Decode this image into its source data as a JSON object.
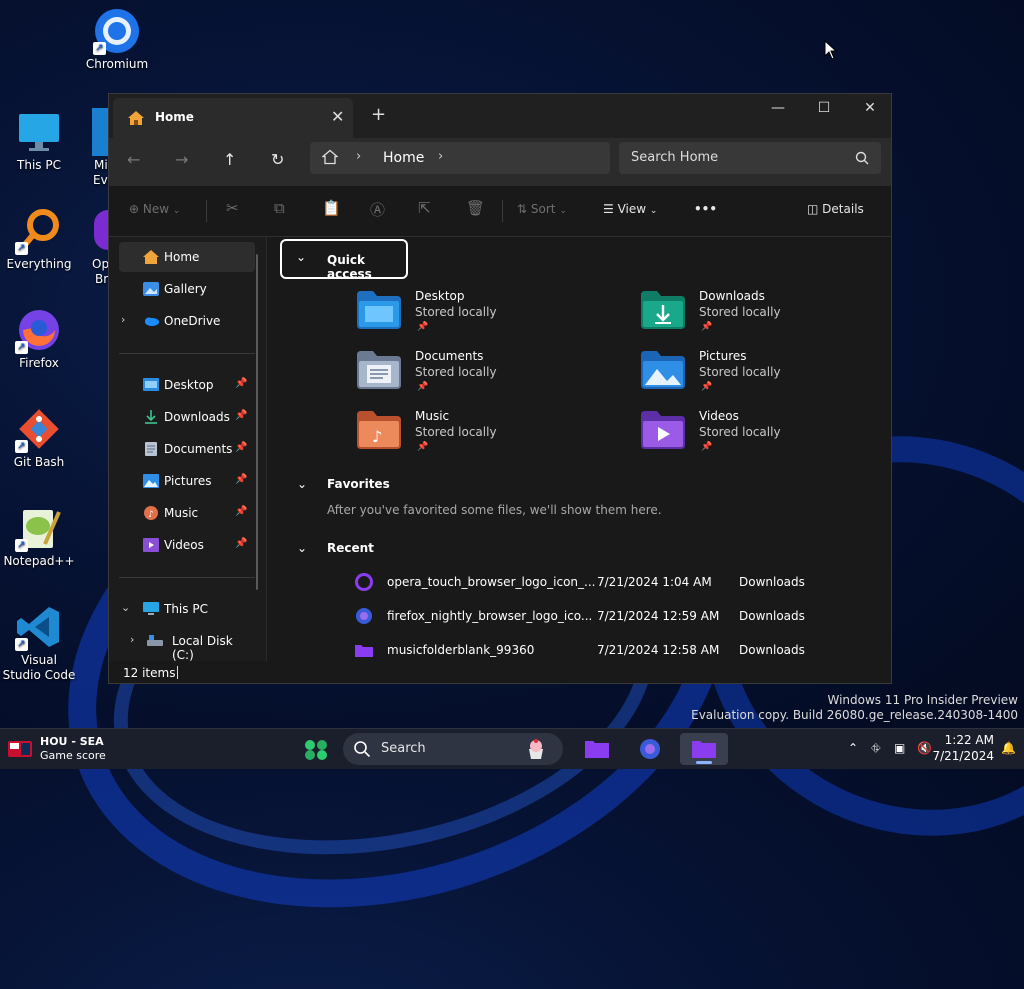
{
  "desktop": {
    "icons": [
      {
        "label": "Chromium",
        "icon": "chromium-icon"
      },
      {
        "label": "This PC",
        "icon": "this-pc-icon"
      },
      {
        "label": "Everything",
        "icon": "everything-icon"
      },
      {
        "label": "Firefox",
        "icon": "firefox-icon"
      },
      {
        "label": "Git Bash",
        "icon": "git-bash-icon"
      },
      {
        "label": "Notepad++",
        "icon": "notepadpp-icon"
      },
      {
        "label": "Visual Studio Code",
        "icon": "vscode-icon"
      }
    ],
    "partial_labels": [
      "Mi",
      "Eve",
      "Op",
      "Br"
    ]
  },
  "window": {
    "tab_title": "Home",
    "address": {
      "crumb": "Home"
    },
    "search_placeholder": "Search Home",
    "toolbar": {
      "new": "New",
      "sort": "Sort",
      "view": "View",
      "more": "•••",
      "details": "Details"
    },
    "sidebar": {
      "top": [
        {
          "label": "Home",
          "icon": "home-icon"
        },
        {
          "label": "Gallery",
          "icon": "gallery-icon"
        },
        {
          "label": "OneDrive",
          "icon": "onedrive-icon"
        }
      ],
      "pinned": [
        {
          "label": "Desktop",
          "icon": "desktop-folder-icon"
        },
        {
          "label": "Downloads",
          "icon": "downloads-folder-icon"
        },
        {
          "label": "Documents",
          "icon": "documents-folder-icon"
        },
        {
          "label": "Pictures",
          "icon": "pictures-folder-icon"
        },
        {
          "label": "Music",
          "icon": "music-folder-icon"
        },
        {
          "label": "Videos",
          "icon": "videos-folder-icon"
        }
      ],
      "this_pc": "This PC",
      "local_disk": "Local Disk (C:)"
    },
    "quick_access": {
      "title": "Quick access",
      "folders": [
        {
          "name": "Desktop",
          "status": "Stored locally",
          "color": "#2a8ce0"
        },
        {
          "name": "Downloads",
          "status": "Stored locally",
          "color": "#1aa88a"
        },
        {
          "name": "Documents",
          "status": "Stored locally",
          "color": "#8a9ab4"
        },
        {
          "name": "Pictures",
          "status": "Stored locally",
          "color": "#2f8fe6"
        },
        {
          "name": "Music",
          "status": "Stored locally",
          "color": "#e0704a"
        },
        {
          "name": "Videos",
          "status": "Stored locally",
          "color": "#8a4fd6"
        }
      ]
    },
    "favorites": {
      "title": "Favorites",
      "note": "After you've favorited some files, we'll show them here."
    },
    "recent": {
      "title": "Recent",
      "rows": [
        {
          "name": "opera_touch_browser_logo_icon_...",
          "date": "7/21/2024 1:04 AM",
          "location": "Downloads",
          "icon": "opera-icon"
        },
        {
          "name": "firefox_nightly_browser_logo_ico...",
          "date": "7/21/2024 12:59 AM",
          "location": "Downloads",
          "icon": "firefox-nightly-icon"
        },
        {
          "name": "musicfolderblank_99360",
          "date": "7/21/2024 12:58 AM",
          "location": "Downloads",
          "icon": "purple-folder-icon"
        }
      ]
    },
    "status": "12 items"
  },
  "watermark": {
    "line1": "Windows 11 Pro Insider Preview",
    "line2": "Evaluation copy. Build 26080.ge_release.240308-1400"
  },
  "taskbar": {
    "weather_title": "HOU - SEA",
    "weather_sub": "Game score",
    "search_placeholder": "Search",
    "time": "1:22 AM",
    "date": "7/21/2024"
  }
}
